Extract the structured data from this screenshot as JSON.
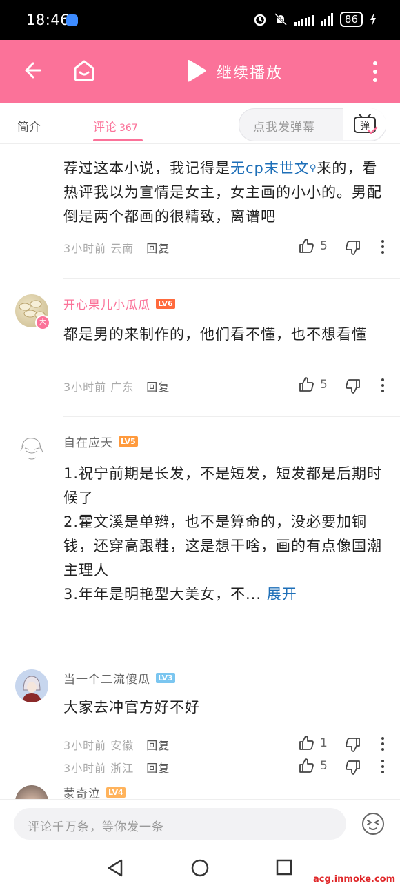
{
  "status_bar": {
    "time": "18:46",
    "battery": "86"
  },
  "header": {
    "continue_label": "继续播放"
  },
  "tabs": {
    "intro": "简介",
    "comments": "评论",
    "comments_count": "367"
  },
  "danmu": {
    "placeholder": "点我发弹幕",
    "button": "弹"
  },
  "comments": [
    {
      "text_before": "荐过这本小说，我记得是",
      "link": "无cp末世文",
      "text_after": "来的，看热评我以为宣情是女主，女主画的小小的。男配倒是两个都画的很精致，离谱吧",
      "time": "3小时前",
      "location": "云南",
      "reply": "回复",
      "likes": "5"
    },
    {
      "username": "开心果儿小瓜瓜",
      "level": "LV6",
      "level_color": "#ff6a3d",
      "name_color": "#fb7299",
      "avatar_badge": "大",
      "text": "都是男的来制作的，他们看不懂，也不想看懂",
      "time": "3小时前",
      "location": "广东",
      "reply": "回复",
      "likes": "5"
    },
    {
      "username": "自在应天",
      "level": "LV5",
      "level_color": "#ff9a3d",
      "name_color": "#666666",
      "text": "1.祝宁前期是长发，不是短发，短发都是后期时候了\n2.霍文溪是单辫，也不是算命的，没必要加铜钱，还穿高跟鞋，这是想干啥，画的有点像国潮主理人\n3.年年是明艳型大美女，不...",
      "expand": "展开",
      "time": "3小时前",
      "location": "浙江",
      "reply": "回复",
      "likes": "5"
    },
    {
      "username": "当一个二流傻瓜",
      "level": "LV3",
      "level_color": "#7bc6f0",
      "name_color": "#666666",
      "text": "大家去冲官方好不好",
      "time": "3小时前",
      "location": "安徽",
      "reply": "回复",
      "likes": "1"
    },
    {
      "username": "蒙奇泣",
      "level": "LV4",
      "level_color": "#ffb35c",
      "name_color": "#666666"
    }
  ],
  "input": {
    "placeholder": "评论千万条，等你发一条"
  },
  "watermark": "acg.inmoke.com"
}
